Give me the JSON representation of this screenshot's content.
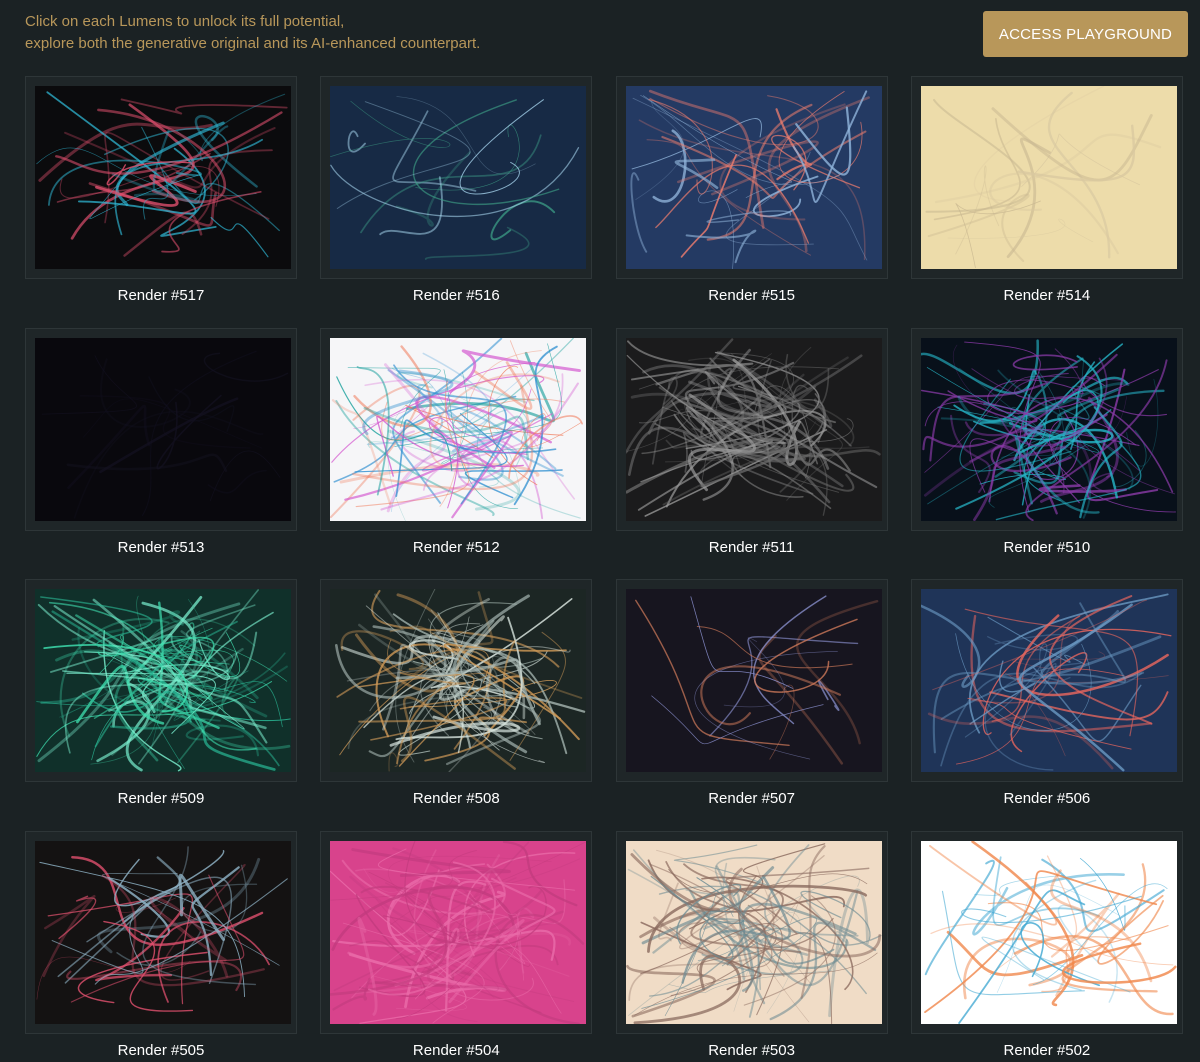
{
  "intro": {
    "line1": "Click on each Lumens to unlock its full potential,",
    "line2": "explore both the generative original and its AI-enhanced counterpart."
  },
  "access_button": {
    "label": "ACCESS PLAYGROUND"
  },
  "colors": {
    "accent": "#b8975a",
    "background": "#1b2224"
  },
  "renders": [
    {
      "label": "Render #517",
      "bg": "#0b0b0d",
      "strokes": [
        "#2fb7d4",
        "#e0506e"
      ],
      "density": "medium"
    },
    {
      "label": "Render #516",
      "bg": "#172a45",
      "strokes": [
        "#a9d8f0",
        "#3fa58a"
      ],
      "density": "low"
    },
    {
      "label": "Render #515",
      "bg": "#243a63",
      "strokes": [
        "#ef7d6e",
        "#8fb3d9"
      ],
      "density": "medium"
    },
    {
      "label": "Render #514",
      "bg": "#eddcaa",
      "strokes": [
        "#c8b791",
        "#d9c9a0"
      ],
      "density": "low"
    },
    {
      "label": "Render #513",
      "bg": "#09080d",
      "strokes": [
        "#141222"
      ],
      "density": "low"
    },
    {
      "label": "Render #512",
      "bg": "#f6f6f8",
      "strokes": [
        "#2f8fd0",
        "#23a3a0",
        "#d45ad0",
        "#f07a5a"
      ],
      "density": "high"
    },
    {
      "label": "Render #511",
      "bg": "#1b1b1c",
      "strokes": [
        "#9a9a9a",
        "#6b6b6b"
      ],
      "density": "high"
    },
    {
      "label": "Render #510",
      "bg": "#08101a",
      "strokes": [
        "#26b6c8",
        "#8a3aa8"
      ],
      "density": "high"
    },
    {
      "label": "Render #509",
      "bg": "#10302a",
      "strokes": [
        "#3fe0b0",
        "#2ab895",
        "#7bf0d0"
      ],
      "density": "high"
    },
    {
      "label": "Render #508",
      "bg": "#1c2624",
      "strokes": [
        "#d6e2dc",
        "#a7b7b2",
        "#d09a58"
      ],
      "density": "high"
    },
    {
      "label": "Render #507",
      "bg": "#17151f",
      "strokes": [
        "#8f95d6",
        "#d07a5a"
      ],
      "density": "low"
    },
    {
      "label": "Render #506",
      "bg": "#1f3458",
      "strokes": [
        "#e8665e",
        "#6d9cc6"
      ],
      "density": "medium"
    },
    {
      "label": "Render #505",
      "bg": "#141212",
      "strokes": [
        "#e0506e",
        "#8fb3c6"
      ],
      "density": "medium"
    },
    {
      "label": "Render #504",
      "bg": "#d8438c",
      "strokes": [
        "#e96aa8",
        "#c23b7e"
      ],
      "density": "high"
    },
    {
      "label": "Render #503",
      "bg": "#f0dcc6",
      "strokes": [
        "#8a6a5e",
        "#6b8a92"
      ],
      "density": "high"
    },
    {
      "label": "Render #502",
      "bg": "#ffffff",
      "strokes": [
        "#3fa7d2",
        "#f0864a"
      ],
      "density": "medium"
    }
  ]
}
